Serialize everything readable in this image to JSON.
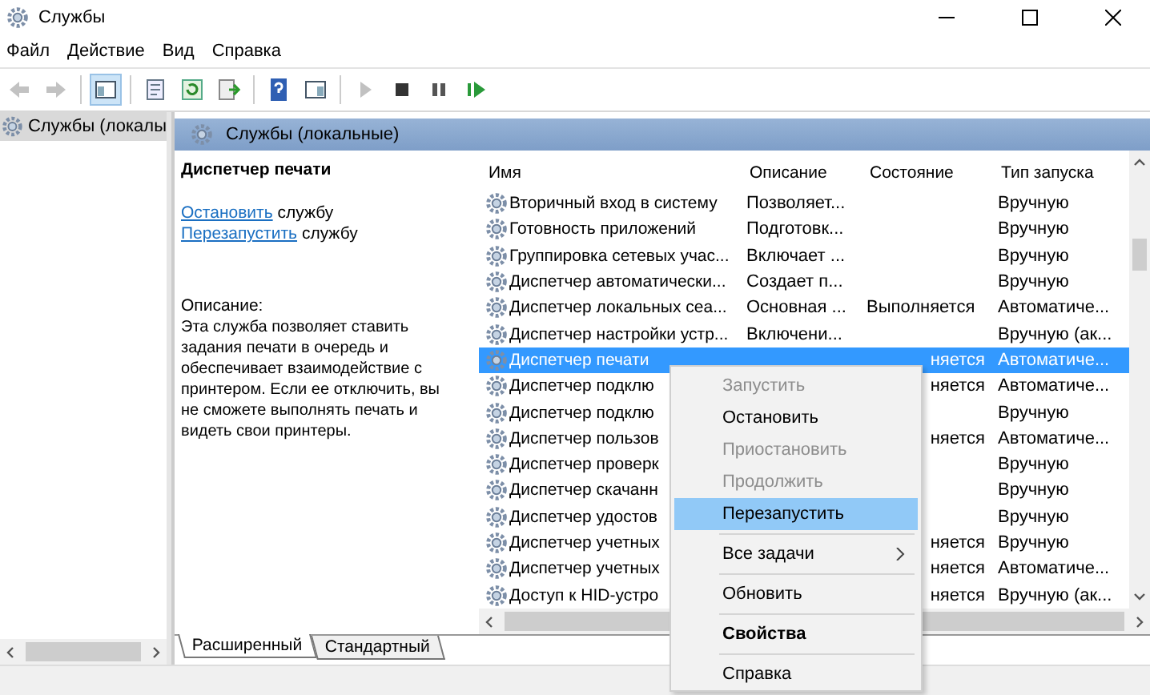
{
  "window": {
    "title": "Службы"
  },
  "menu_bar": [
    "Файл",
    "Действие",
    "Вид",
    "Справка"
  ],
  "toolbar": [
    {
      "kind": "back",
      "disabled": true,
      "selected": false
    },
    {
      "kind": "forward",
      "disabled": true,
      "selected": false
    },
    {
      "kind": "tree",
      "disabled": false,
      "selected": true
    },
    {
      "kind": "sheet",
      "disabled": false,
      "selected": false
    },
    {
      "kind": "refresh",
      "disabled": false,
      "selected": false
    },
    {
      "kind": "export",
      "disabled": false,
      "selected": false
    },
    {
      "kind": "help",
      "disabled": false,
      "selected": false
    },
    {
      "kind": "pane",
      "disabled": false,
      "selected": false
    },
    {
      "kind": "play",
      "disabled": true,
      "selected": false
    },
    {
      "kind": "stop",
      "disabled": false,
      "selected": false
    },
    {
      "kind": "pause",
      "disabled": false,
      "selected": false
    },
    {
      "kind": "restart",
      "disabled": false,
      "selected": false
    }
  ],
  "tree": {
    "items": [
      {
        "label": "Службы (локалы",
        "selected": true
      }
    ]
  },
  "pane_header": "Службы (локальные)",
  "details": {
    "title": "Диспетчер печати",
    "actions": [
      {
        "link": "Остановить",
        "text": "службу"
      },
      {
        "link": "Перезапустить",
        "text": "службу"
      }
    ],
    "description_label": "Описание:",
    "description": "Эта служба позволяет ставить задания печати в очередь и обеспечивает взаимодействие с принтером. Если ее отключить, вы не сможете выполнять печать и видеть свои принтеры."
  },
  "table": {
    "columns": [
      "Имя",
      "Описание",
      "Состояние",
      "Тип запуска"
    ],
    "rows": [
      {
        "name": "Вторичный вход в систему",
        "description": "Позволяет...",
        "state": "",
        "startup": "Вручную",
        "selected": false
      },
      {
        "name": "Готовность приложений",
        "description": "Подготовк...",
        "state": "",
        "startup": "Вручную",
        "selected": false
      },
      {
        "name": "Группировка сетевых учас...",
        "description": "Включает ...",
        "state": "",
        "startup": "Вручную",
        "selected": false
      },
      {
        "name": "Диспетчер автоматически...",
        "description": "Создает п...",
        "state": "",
        "startup": "Вручную",
        "selected": false
      },
      {
        "name": "Диспетчер локальных сеа...",
        "description": "Основная ...",
        "state": "Выполняется",
        "startup": "Автоматиче...",
        "selected": false
      },
      {
        "name": "Диспетчер настройки устр...",
        "description": "Включени...",
        "state": "",
        "startup": "Вручную (ак...",
        "selected": false
      },
      {
        "name": "Диспетчер печати",
        "description": "",
        "state": "няется",
        "startup": "Автоматиче...",
        "selected": true
      },
      {
        "name": "Диспетчер подклю",
        "description": "",
        "state": "няется",
        "startup": "Автоматиче...",
        "selected": false
      },
      {
        "name": "Диспетчер подклю",
        "description": "",
        "state": "",
        "startup": "Вручную",
        "selected": false
      },
      {
        "name": "Диспетчер пользов",
        "description": "",
        "state": "няется",
        "startup": "Автоматиче...",
        "selected": false
      },
      {
        "name": "Диспетчер проверк",
        "description": "",
        "state": "",
        "startup": "Вручную",
        "selected": false
      },
      {
        "name": "Диспетчер скачанн",
        "description": "",
        "state": "",
        "startup": "Вручную",
        "selected": false
      },
      {
        "name": "Диспетчер удостов",
        "description": "",
        "state": "",
        "startup": "Вручную",
        "selected": false
      },
      {
        "name": "Диспетчер учетных",
        "description": "",
        "state": "няется",
        "startup": "Вручную",
        "selected": false
      },
      {
        "name": "Диспетчер учетных",
        "description": "",
        "state": "няется",
        "startup": "Автоматиче...",
        "selected": false
      },
      {
        "name": "Доступ к HID-устро",
        "description": "",
        "state": "няется",
        "startup": "Вручную (ак...",
        "selected": false
      }
    ]
  },
  "view_tabs": [
    {
      "label": "Расширенный",
      "selected": true
    },
    {
      "label": "Стандартный",
      "selected": false
    }
  ],
  "context_menu": [
    {
      "kind": "item",
      "label": "Запустить",
      "disabled": true,
      "selected": false,
      "default": false,
      "submenu": false
    },
    {
      "kind": "item",
      "label": "Остановить",
      "disabled": false,
      "selected": false,
      "default": false,
      "submenu": false
    },
    {
      "kind": "item",
      "label": "Приостановить",
      "disabled": true,
      "selected": false,
      "default": false,
      "submenu": false
    },
    {
      "kind": "item",
      "label": "Продолжить",
      "disabled": true,
      "selected": false,
      "default": false,
      "submenu": false
    },
    {
      "kind": "item",
      "label": "Перезапустить",
      "disabled": false,
      "selected": true,
      "default": false,
      "submenu": false
    },
    {
      "kind": "separator"
    },
    {
      "kind": "item",
      "label": "Все задачи",
      "disabled": false,
      "selected": false,
      "default": false,
      "submenu": true
    },
    {
      "kind": "separator"
    },
    {
      "kind": "item",
      "label": "Обновить",
      "disabled": false,
      "selected": false,
      "default": false,
      "submenu": false
    },
    {
      "kind": "separator"
    },
    {
      "kind": "item",
      "label": "Свойства",
      "disabled": false,
      "selected": false,
      "default": true,
      "submenu": false
    },
    {
      "kind": "separator"
    },
    {
      "kind": "item",
      "label": "Справка",
      "disabled": false,
      "selected": false,
      "default": false,
      "submenu": false
    }
  ]
}
